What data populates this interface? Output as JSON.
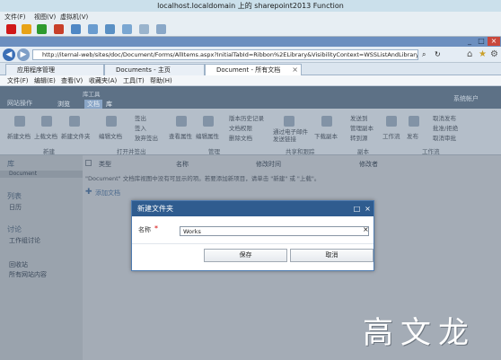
{
  "vm": {
    "title": "localhost.localdomain 上的 sharepoint2013 Function",
    "menus": [
      "文件(F)",
      "视图(V)",
      "虚拟机(V)"
    ]
  },
  "guest": {
    "controls": [
      "_",
      "□",
      "×"
    ]
  },
  "browser": {
    "url": "http://iternal-web/sites/doc/Document/Forms/AllItems.aspx?InitialTabId=Ribbon%2ELibrary&VisibilityContext=WSSListAndLibrary",
    "tabs": [
      {
        "label": "应用程序管理",
        "active": false
      },
      {
        "label": "Documents - 主页",
        "active": false
      },
      {
        "label": "Document - 所有文档",
        "active": true
      }
    ],
    "menu": [
      "文件(F)",
      "编辑(E)",
      "查看(V)",
      "收藏夹(A)",
      "工具(T)",
      "帮助(H)"
    ]
  },
  "sharepoint": {
    "top_left": "网站操作",
    "user": "系统帐户",
    "ribbon_tabs": [
      "浏览",
      "文档",
      "库"
    ],
    "library_tools": "库工具",
    "ribbon_items": [
      "新建文档",
      "上载文档",
      "新建文件夹",
      "编辑文档",
      "签出",
      "签入",
      "放弃签出",
      "查看属性",
      "编辑属性",
      "版本历史记录",
      "文档权限",
      "删除文档",
      "通过电子邮件发送链接",
      "下载副本",
      "发送到",
      "管理副本",
      "转到源",
      "工作流",
      "发布",
      "取消发布",
      "批准/拒绝",
      "取消审批"
    ],
    "ribbon_groups": [
      "新建",
      "打开并签出",
      "管理",
      "共享和跟踪",
      "副本",
      "工作流"
    ],
    "left_nav": [
      "库",
      "Document",
      "列表",
      "日历",
      "讨论",
      "工作组讨论",
      "回收站",
      "所有网站内容"
    ],
    "col_headers": [
      "类型",
      "名称",
      "修改时间",
      "修改者"
    ],
    "empty_msg": "\"Document\" 文档库视图中没有可显示的项。若要添加新项目，请单击 \"新建\" 或 \"上载\"。",
    "add_doc": "添加文档"
  },
  "dialog": {
    "title": "新建文件夹",
    "name_label": "名称",
    "required_marker": "*",
    "name_value": "Works",
    "save_label": "保存",
    "cancel_label": "取消",
    "ctl_restore": "□",
    "ctl_close": "×",
    "clear_glyph": "×"
  },
  "watermark": "高文龙"
}
